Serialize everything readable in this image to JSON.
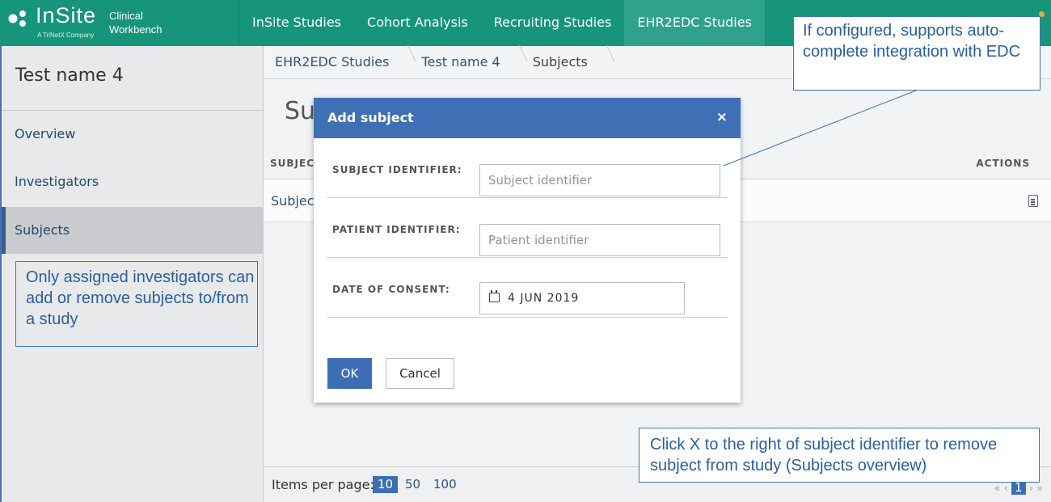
{
  "brand": {
    "name": "InSite",
    "tagline": "A TriNetX Company",
    "product_line1": "Clinical",
    "product_line2": "Workbench"
  },
  "nav": [
    {
      "label": "InSite Studies"
    },
    {
      "label": "Cohort Analysis"
    },
    {
      "label": "Recruiting Studies"
    },
    {
      "label": "EHR2EDC Studies",
      "active": true
    }
  ],
  "sidebar": {
    "title": "Test name 4",
    "items": [
      {
        "label": "Overview"
      },
      {
        "label": "Investigators"
      },
      {
        "label": "Subjects",
        "active": true
      }
    ]
  },
  "breadcrumb": [
    {
      "label": "EHR2EDC Studies"
    },
    {
      "label": "Test name 4"
    },
    {
      "label": "Subjects"
    }
  ],
  "main": {
    "title_partial": "Su",
    "table_header_left": "SUBJECT",
    "table_header_right": "ACTIONS",
    "row_partial": "Subject"
  },
  "footer": {
    "items_per_page_label": "Items per page:",
    "page_sizes": [
      "10",
      "50",
      "100"
    ],
    "selected_size": "10",
    "current_page": "1"
  },
  "modal": {
    "title": "Add subject",
    "close": "×",
    "fields": [
      {
        "label": "SUBJECT IDENTIFIER:",
        "placeholder": "Subject identifier"
      },
      {
        "label": "PATIENT IDENTIFIER:",
        "placeholder": "Patient identifier"
      },
      {
        "label": "DATE OF CONSENT:",
        "value": "4 JUN 2019"
      }
    ],
    "ok_label": "OK",
    "cancel_label": "Cancel"
  },
  "callouts": {
    "edc": "If configured, supports auto-complete integration with EDC",
    "investigators": "Only assigned investigators can add or remove subjects to/from a study",
    "remove": "Click X to the right of subject identifier to remove subject from study (Subjects overview)"
  },
  "colors": {
    "header": "#16957b",
    "accent": "#3f6fb5",
    "callout_text": "#2a5fa0"
  }
}
